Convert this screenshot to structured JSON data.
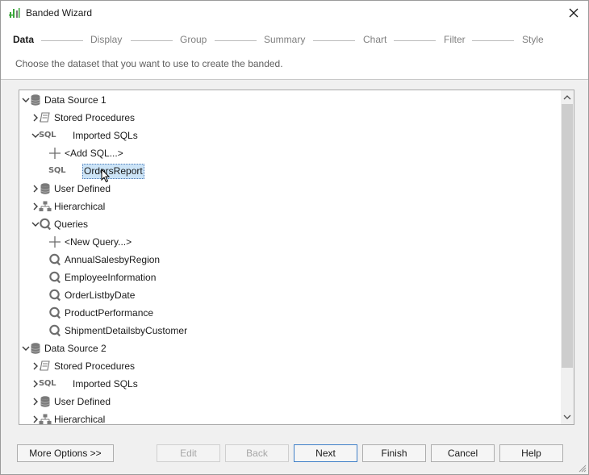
{
  "window": {
    "title": "Banded Wizard"
  },
  "steps": [
    "Data",
    "Display",
    "Group",
    "Summary",
    "Chart",
    "Filter",
    "Style"
  ],
  "subtitle": "Choose the dataset that you want to use to create the banded.",
  "tree": [
    {
      "label": "Data Source 1",
      "icon": "database-icon",
      "expander": "expanded",
      "level": 0
    },
    {
      "label": "Stored Procedures",
      "icon": "scroll-icon",
      "expander": "collapsed",
      "level": 1
    },
    {
      "label": "Imported SQLs",
      "icon": "sql-icon",
      "expander": "expanded",
      "level": 1
    },
    {
      "label": "<Add SQL...>",
      "icon": "plus-icon",
      "expander": "none",
      "level": 2
    },
    {
      "label": "OrdersReport",
      "icon": "sql-icon",
      "expander": "none",
      "level": 2,
      "selected": true
    },
    {
      "label": "User Defined",
      "icon": "database-icon",
      "expander": "collapsed",
      "level": 1
    },
    {
      "label": "Hierarchical",
      "icon": "hierarchy-icon",
      "expander": "collapsed",
      "level": 1
    },
    {
      "label": "Queries",
      "icon": "query-icon",
      "expander": "expanded",
      "level": 1
    },
    {
      "label": "<New Query...>",
      "icon": "plus-icon",
      "expander": "none",
      "level": 2
    },
    {
      "label": "AnnualSalesbyRegion",
      "icon": "query-icon",
      "expander": "none",
      "level": 2
    },
    {
      "label": "EmployeeInformation",
      "icon": "query-icon",
      "expander": "none",
      "level": 2
    },
    {
      "label": "OrderListbyDate",
      "icon": "query-icon",
      "expander": "none",
      "level": 2
    },
    {
      "label": "ProductPerformance",
      "icon": "query-icon",
      "expander": "none",
      "level": 2
    },
    {
      "label": "ShipmentDetailsbyCustomer",
      "icon": "query-icon",
      "expander": "none",
      "level": 2
    },
    {
      "label": "Data Source 2",
      "icon": "database-icon",
      "expander": "expanded",
      "level": 0
    },
    {
      "label": "Stored Procedures",
      "icon": "scroll-icon",
      "expander": "collapsed",
      "level": 1
    },
    {
      "label": "Imported SQLs",
      "icon": "sql-icon",
      "expander": "collapsed",
      "level": 1
    },
    {
      "label": "User Defined",
      "icon": "database-icon",
      "expander": "collapsed",
      "level": 1
    },
    {
      "label": "Hierarchical",
      "icon": "hierarchy-icon",
      "expander": "collapsed",
      "level": 1
    }
  ],
  "sql_icon_text": "SQL",
  "buttons": {
    "more_options": "More Options >>",
    "edit": "Edit",
    "back": "Back",
    "next": "Next",
    "finish": "Finish",
    "cancel": "Cancel",
    "help": "Help"
  },
  "colors": {
    "accent": "#4080c8",
    "selection": "#cce4f7",
    "icon_gray": "#6d6d6d",
    "app_icon_green": "#3aa63a"
  }
}
